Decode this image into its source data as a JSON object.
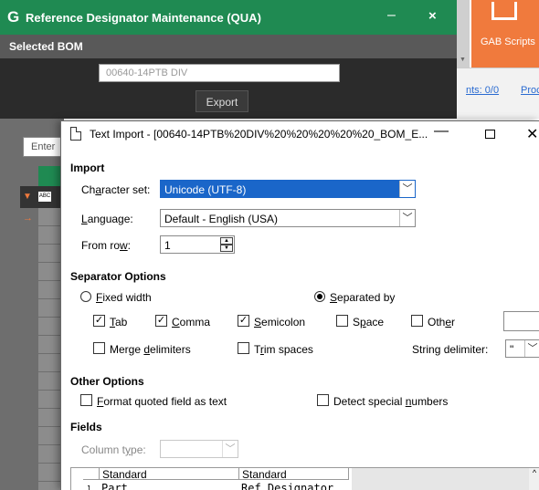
{
  "background_app": {
    "logo": "G",
    "title": "Reference Designator Maintenance (QUA)",
    "minimize": "–",
    "close": "×",
    "selected_bom_label": "Selected BOM",
    "bom_value": "00640-14PTB DIV",
    "export_label": "Export",
    "gab_scripts_label": "GAB Scripts",
    "link_1": "nts: 0/0",
    "link_2": "Proc",
    "enter_placeholder": "Enter",
    "abc_icon": "ABC",
    "accent_color": "#1f8a52",
    "orange_color": "#f07a3d"
  },
  "dialog": {
    "title": "Text Import - [00640-14PTB%20DIV%20%20%20%20%20_BOM_E...",
    "minimize": "—",
    "close": "✕",
    "import_section": "Import",
    "charset_label_pre": "Ch",
    "charset_label_u": "a",
    "charset_label_post": "racter set:",
    "charset_value": "Unicode (UTF-8)",
    "language_label_u": "L",
    "language_label_post": "anguage:",
    "language_value": "Default - English (USA)",
    "fromrow_label_pre": "From ro",
    "fromrow_label_u": "w",
    "fromrow_label_post": ":",
    "fromrow_value": "1",
    "separator_section": "Separator Options",
    "fixed_width_u": "F",
    "fixed_width_post": "ixed width",
    "separated_by_u": "S",
    "separated_by_post": "eparated by",
    "tab_u": "T",
    "tab_post": "ab",
    "comma_u": "C",
    "comma_post": "omma",
    "semicolon_u": "S",
    "semicolon_post": "emicolon",
    "space_pre": "S",
    "space_u": "p",
    "space_post": "ace",
    "other_pre": "Oth",
    "other_u": "e",
    "other_post": "r",
    "merge_pre": "Merge ",
    "merge_u": "d",
    "merge_post": "elimiters",
    "trim_pre": "T",
    "trim_u": "r",
    "trim_post": "im spaces",
    "string_delim_pre": "Strin",
    "string_delim_u": "g",
    "string_delim_post": " delimiter:",
    "string_delim_value": "\"",
    "other_options_section": "Other Options",
    "format_quoted_u": "F",
    "format_quoted_post": "ormat quoted field as text",
    "detect_special_pre": "Detect special ",
    "detect_special_u": "n",
    "detect_special_post": "umbers",
    "fields_section": "Fields",
    "column_type_pre": "Column t",
    "column_type_u": "y",
    "column_type_post": "pe:",
    "check_mark": "✓",
    "preview_headers": [
      "Standard",
      "Standard"
    ],
    "preview_row": [
      "Part",
      "Ref Designator"
    ],
    "selection_color": "#1a66c9"
  }
}
